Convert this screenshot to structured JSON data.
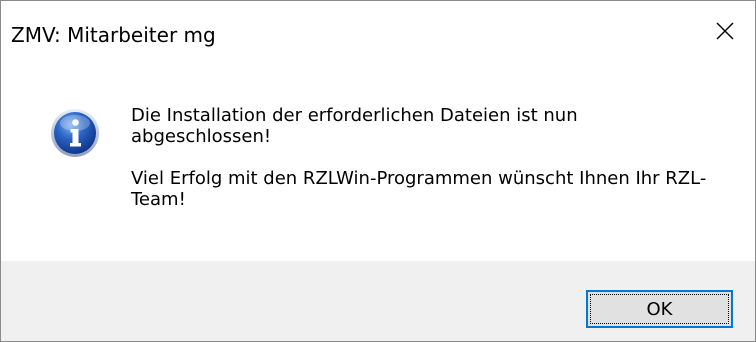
{
  "window": {
    "title": "ZMV: Mitarbeiter mg"
  },
  "titlebar": {
    "close_icon": "close-icon",
    "close_symbol": "✕"
  },
  "message": {
    "icon": "info-icon",
    "line1": "Die Installation der erforderlichen Dateien ist nun abgeschlossen!",
    "line2": "Viel Erfolg mit den RZLWin-Programmen wünscht Ihnen Ihr RZL-Team!"
  },
  "footer": {
    "ok_label": "OK"
  },
  "colors": {
    "accent": "#0078d7",
    "footer_bg": "#f0f0f0",
    "button_bg": "#e1e1e1"
  }
}
